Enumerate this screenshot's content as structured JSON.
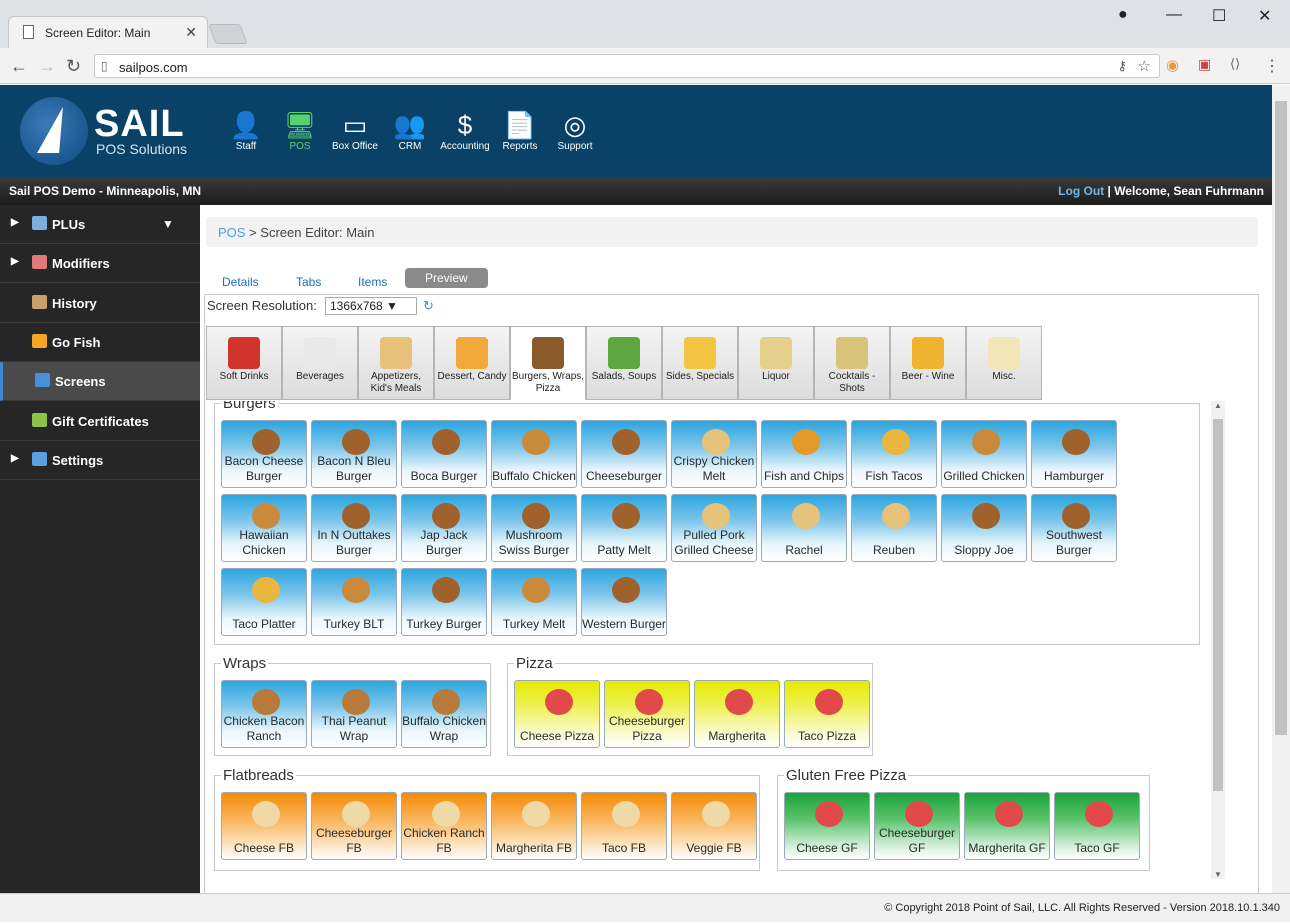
{
  "browser": {
    "tab_title": "Screen Editor: Main",
    "url": "sailpos.com"
  },
  "brand": {
    "name": "SAIL",
    "sub": "POS Solutions"
  },
  "nav": [
    {
      "label": "Staff",
      "icon": "person-icon",
      "glyph": "👤"
    },
    {
      "label": "POS",
      "icon": "monitor-icon",
      "glyph": "🖥"
    },
    {
      "label": "Box Office",
      "icon": "ticket-icon",
      "glyph": "▭"
    },
    {
      "label": "CRM",
      "icon": "group-icon",
      "glyph": "👥"
    },
    {
      "label": "Accounting",
      "icon": "dollar-icon",
      "glyph": "$"
    },
    {
      "label": "Reports",
      "icon": "document-icon",
      "glyph": "📄"
    },
    {
      "label": "Support",
      "icon": "lifebuoy-icon",
      "glyph": "◎"
    }
  ],
  "location": "Sail POS Demo - Minneapolis, MN",
  "account": {
    "logout": "Log Out",
    "sep": " | ",
    "welcome": "Welcome, Sean Fuhrmann"
  },
  "sidebar": [
    {
      "label": "PLUs",
      "arrow": "▶",
      "color": "#7ab0e0"
    },
    {
      "label": "Modifiers",
      "arrow": "▶",
      "color": "#e07a7a"
    },
    {
      "label": "History",
      "arrow": "",
      "color": "#c9a06a"
    },
    {
      "label": "Go Fish",
      "arrow": "",
      "color": "#f5a623"
    },
    {
      "label": "Screens",
      "arrow": "",
      "color": "#4a90d9"
    },
    {
      "label": "Gift Certificates",
      "arrow": "",
      "color": "#8bc34a"
    },
    {
      "label": "Settings",
      "arrow": "▶",
      "color": "#5aa0e0"
    }
  ],
  "breadcrumb": {
    "root": "POS",
    "sep": " > ",
    "current": "Screen Editor: Main"
  },
  "tabs": [
    "Details",
    "Tabs",
    "Items",
    "Preview"
  ],
  "resolution": {
    "label": "Screen Resolution:",
    "value": "1366x768 ▼"
  },
  "categories": [
    {
      "label": "Soft Drinks",
      "color": "#d0342c"
    },
    {
      "label": "Beverages",
      "color": "#e9e9e9"
    },
    {
      "label": "Appetizers, Kid's Meals",
      "color": "#e8c27a"
    },
    {
      "label": "Dessert, Candy",
      "color": "#f2a93b"
    },
    {
      "label": "Burgers, Wraps, Pizza",
      "color": "#8b5a2b"
    },
    {
      "label": "Salads, Soups",
      "color": "#5da640"
    },
    {
      "label": "Sides, Specials",
      "color": "#f4c542"
    },
    {
      "label": "Liquor",
      "color": "#e6cf8a"
    },
    {
      "label": "Cocktails - Shots",
      "color": "#d9c27a"
    },
    {
      "label": "Beer - Wine",
      "color": "#f0b32e"
    },
    {
      "label": "Misc.",
      "color": "#f3e6b8"
    }
  ],
  "groups": {
    "burgers": {
      "title": "Burgers",
      "items": [
        "Bacon Cheese Burger",
        "Bacon N Bleu Burger",
        "Boca Burger",
        "Buffalo Chicken",
        "Cheeseburger",
        "Crispy Chicken Melt",
        "Fish and Chips",
        "Fish Tacos",
        "Grilled Chicken",
        "Hamburger",
        "Hawaiian Chicken",
        "In N Outtakes Burger",
        "Jap Jack Burger",
        "Mushroom Swiss Burger",
        "Patty Melt",
        "Pulled Pork Grilled Cheese",
        "Rachel",
        "Reuben",
        "Sloppy Joe",
        "Southwest Burger",
        "Taco Platter",
        "Turkey BLT",
        "Turkey Burger",
        "Turkey Melt",
        "Western Burger"
      ],
      "icons": [
        "burger",
        "burger",
        "burger",
        "chicken",
        "burger",
        "sandwich",
        "fish",
        "taco",
        "chicken",
        "burger",
        "chicken",
        "burger",
        "burger",
        "burger",
        "burger",
        "sandwich",
        "sandwich",
        "sandwich",
        "burger",
        "burger",
        "taco",
        "chicken",
        "burger",
        "chicken",
        "burger"
      ]
    },
    "wraps": {
      "title": "Wraps",
      "items": [
        "Chicken Bacon Ranch",
        "Thai Peanut Wrap",
        "Buffalo Chicken Wrap"
      ]
    },
    "pizza": {
      "title": "Pizza",
      "items": [
        "Cheese Pizza",
        "Cheeseburger Pizza",
        "Margherita",
        "Taco Pizza"
      ]
    },
    "flatbreads": {
      "title": "Flatbreads",
      "items": [
        "Cheese FB",
        "Cheeseburger FB",
        "Chicken Ranch FB",
        "Margherita FB",
        "Taco FB",
        "Veggie FB"
      ]
    },
    "gluten_free": {
      "title": "Gluten Free Pizza",
      "items": [
        "Cheese GF",
        "Cheeseburger GF",
        "Margherita GF",
        "Taco GF"
      ]
    }
  },
  "icon_colors": {
    "burger": "#a0622d",
    "chicken": "#c98a3b",
    "sandwich": "#e7c27a",
    "fish": "#e39a2a",
    "taco": "#e9b640",
    "wrap": "#b87a3a",
    "pizza": "#e2494a",
    "flatbread": "#efd9a6"
  },
  "footer": "© Copyright 2018 Point of Sail, LLC. All Rights Reserved - Version 2018.10.1.340"
}
